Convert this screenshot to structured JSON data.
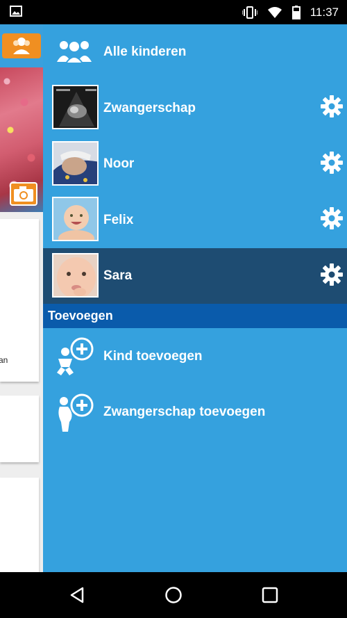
{
  "status_bar": {
    "time": "11:37",
    "icons": [
      "gallery-icon",
      "vibrate-icon",
      "wifi-icon",
      "battery-icon"
    ]
  },
  "background_app": {
    "partial_text": "an"
  },
  "drawer": {
    "all_children": {
      "label": "Alle kinderen",
      "icon": "group-icon"
    },
    "children": [
      {
        "label": "Zwangerschap",
        "thumb": "ultrasound-photo",
        "active": false
      },
      {
        "label": "Noor",
        "thumb": "sleeping-baby-photo",
        "active": false
      },
      {
        "label": "Felix",
        "thumb": "smiling-baby-photo",
        "active": false
      },
      {
        "label": "Sara",
        "thumb": "baby-face-photo",
        "active": true
      }
    ],
    "section_title": "Toevoegen",
    "add_actions": [
      {
        "label": "Kind toevoegen",
        "icon": "add-child-icon"
      },
      {
        "label": "Zwangerschap toevoegen",
        "icon": "add-pregnancy-icon"
      }
    ]
  },
  "colors": {
    "drawer_bg": "#35a1de",
    "active_row": "#1e4c72",
    "section_header": "#0a5bab",
    "accent_orange": "#f08f21"
  },
  "nav_bar": {
    "buttons": [
      "back-icon",
      "home-icon",
      "recents-icon"
    ]
  }
}
